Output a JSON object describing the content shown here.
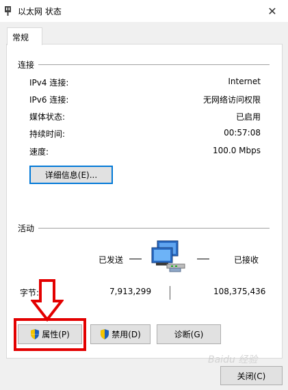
{
  "window": {
    "title": "以太网 状态",
    "close_glyph": "✕"
  },
  "tab": {
    "label": "常规"
  },
  "connection": {
    "heading": "连接",
    "rows": [
      {
        "label": "IPv4 连接:",
        "value": "Internet"
      },
      {
        "label": "IPv6 连接:",
        "value": "无网络访问权限"
      },
      {
        "label": "媒体状态:",
        "value": "已启用"
      },
      {
        "label": "持续时间:",
        "value": "00:57:08"
      },
      {
        "label": "速度:",
        "value": "100.0 Mbps"
      }
    ],
    "details_button": "详细信息(E)..."
  },
  "activity": {
    "heading": "活动",
    "sent_label": "已发送",
    "received_label": "已接收",
    "bytes_label": "字节:",
    "sent_value": "7,913,299",
    "received_value": "108,375,436"
  },
  "buttons": {
    "properties": "属性(P)",
    "disable": "禁用(D)",
    "diagnose": "诊断(G)",
    "close": "关闭(C)"
  },
  "watermark": {
    "text": "Baidu 经验"
  },
  "colors": {
    "highlight_red": "#e30000",
    "focus_blue": "#0078d7",
    "shield_blue": "#1f5fb8",
    "shield_yellow": "#f5c400"
  }
}
